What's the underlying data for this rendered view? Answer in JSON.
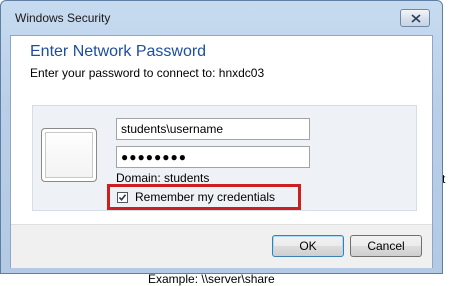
{
  "background": {
    "right_fragment": "t",
    "example_text": "Example: \\\\server\\share"
  },
  "dialog": {
    "title": "Windows Security",
    "heading": "Enter Network Password",
    "subtitle": "Enter your password to connect to: hnxdc03",
    "username_value": "students\\username",
    "password_mask": "●●●●●●●●",
    "domain_text": "Domain: students",
    "remember_label": "Remember my credentials",
    "remember_checked": true,
    "ok_label": "OK",
    "cancel_label": "Cancel"
  },
  "colors": {
    "heading": "#1c4d9e",
    "highlight_box": "#cc1f1f",
    "frame": "#b9cfe8"
  }
}
